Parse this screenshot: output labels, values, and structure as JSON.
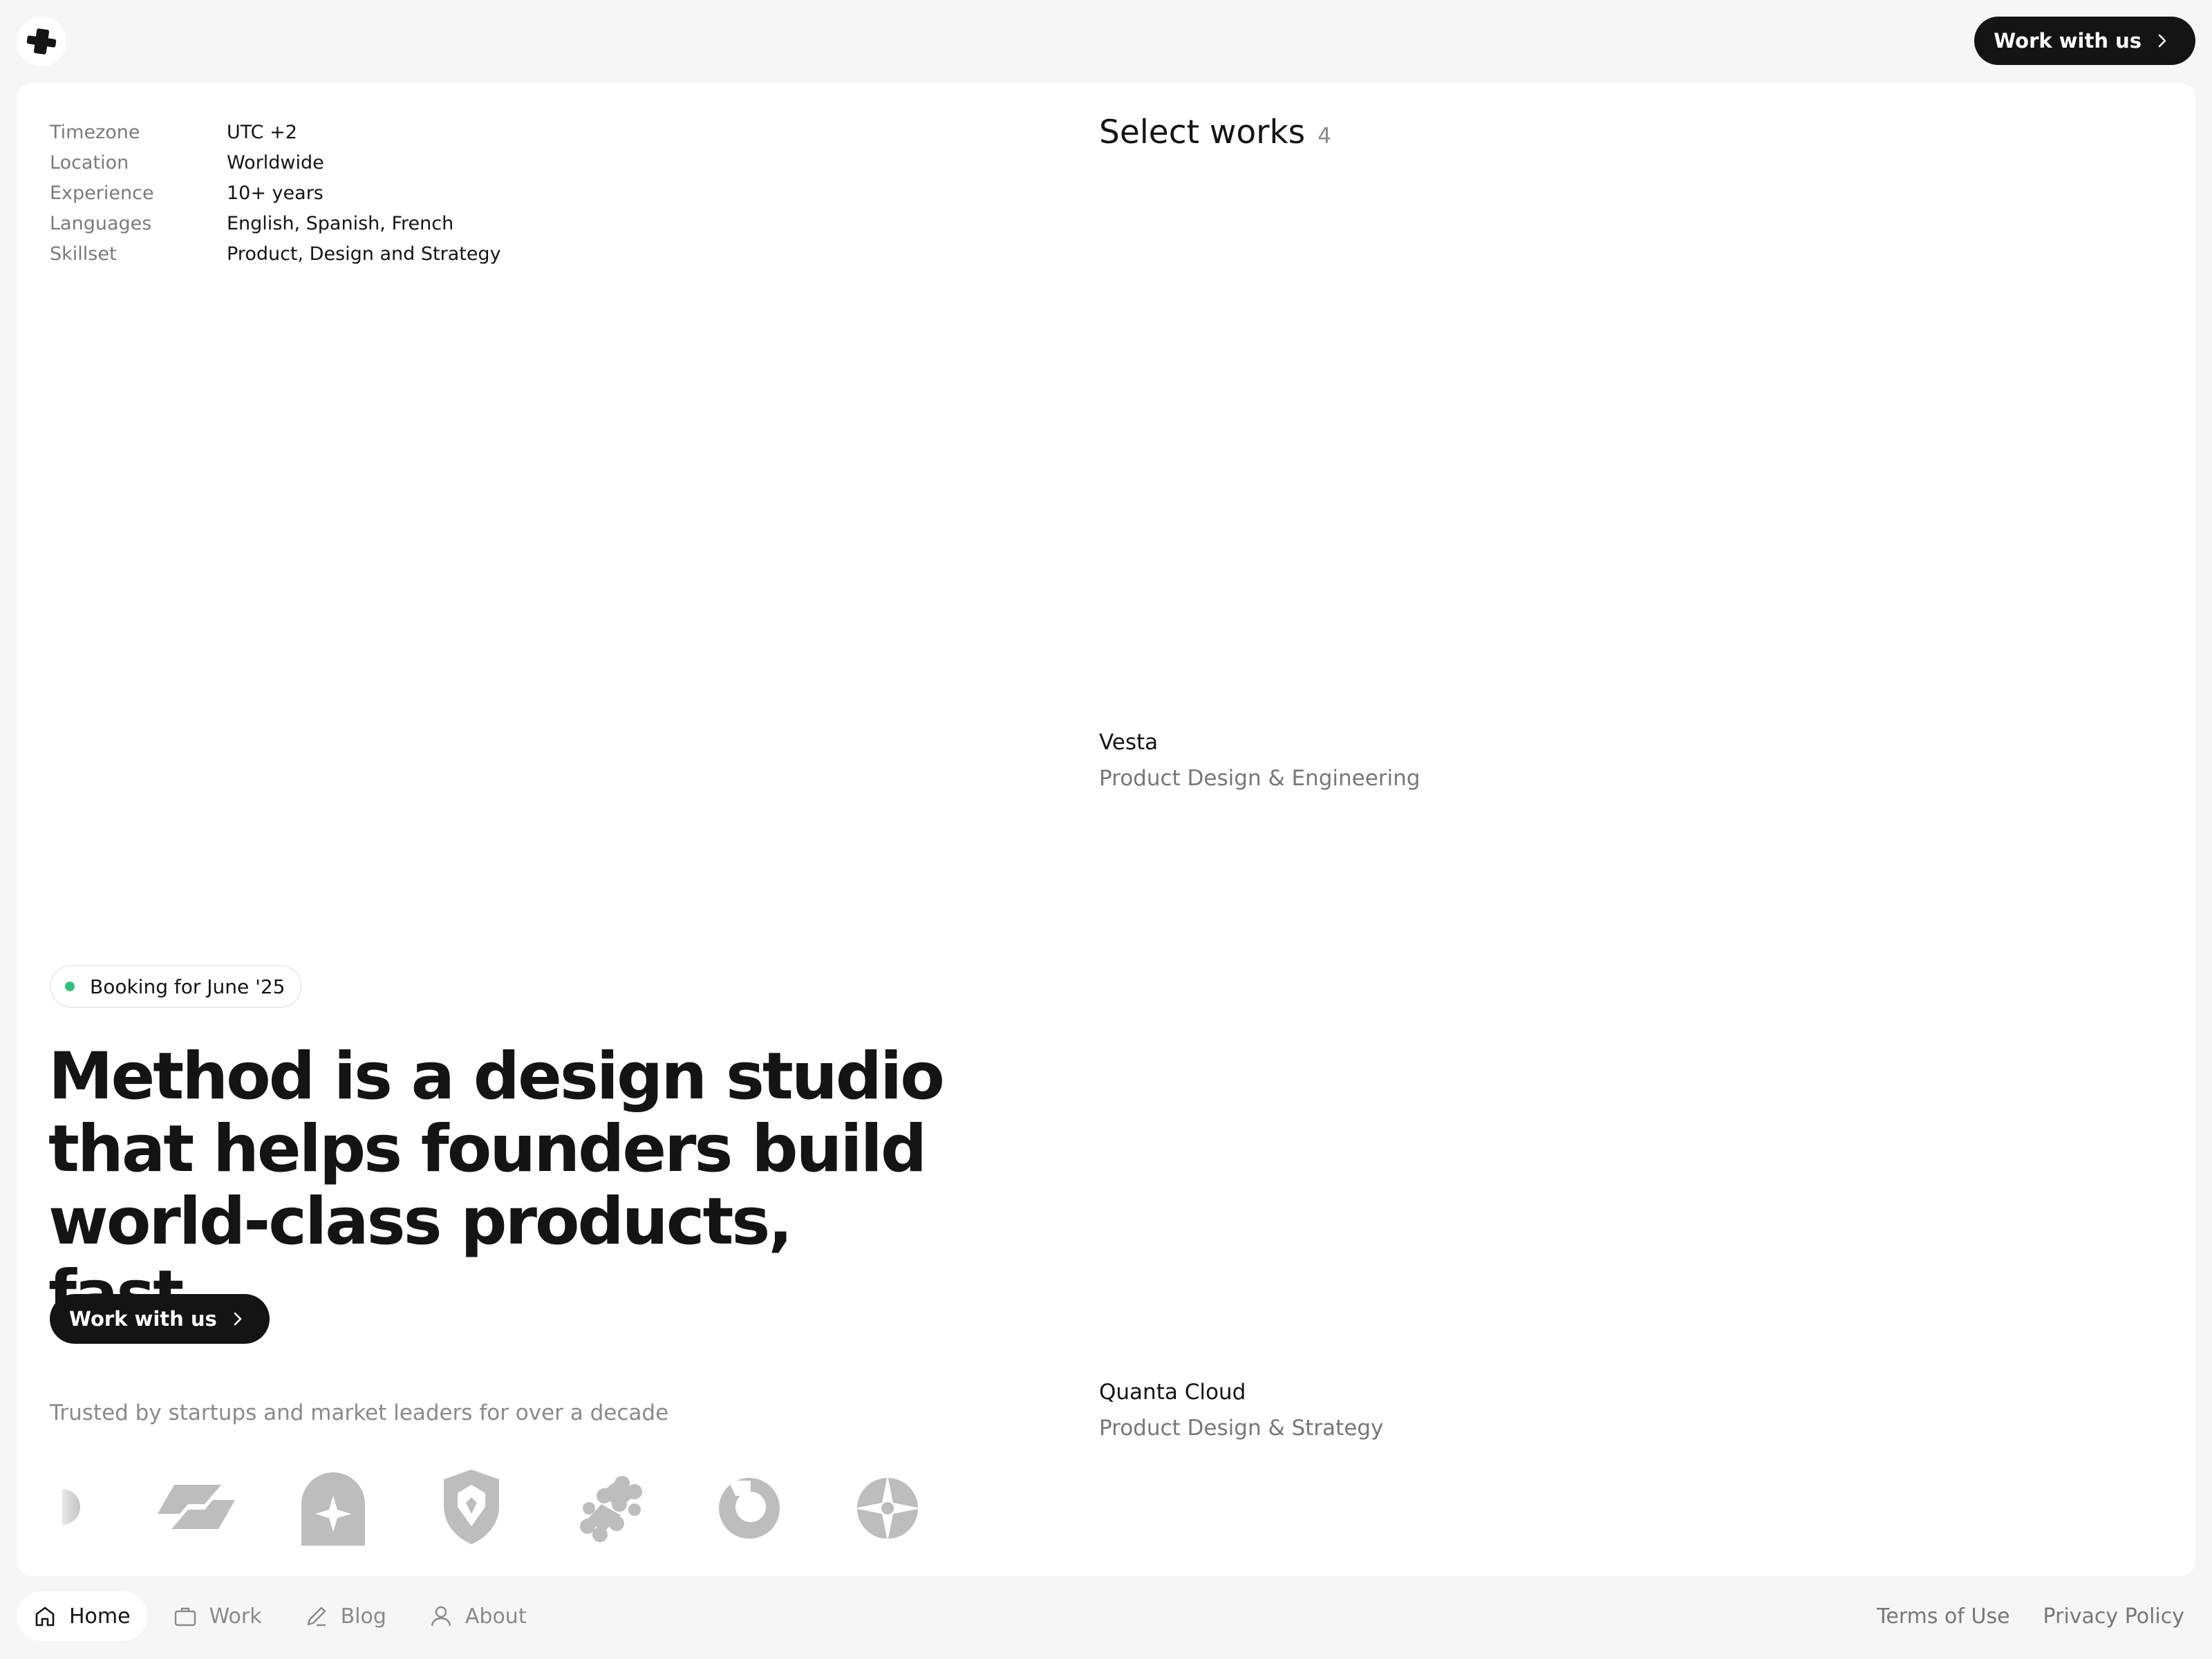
{
  "header": {
    "logo_icon": "plus-icon",
    "cta_label": "Work with us"
  },
  "info": [
    {
      "label": "Timezone",
      "value": "UTC +2"
    },
    {
      "label": "Location",
      "value": "Worldwide"
    },
    {
      "label": "Experience",
      "value": "10+ years"
    },
    {
      "label": "Languages",
      "value": "English, Spanish, French"
    },
    {
      "label": "Skillset",
      "value": "Product, Design and Strategy"
    }
  ],
  "works": {
    "title": "Select works",
    "count": "4",
    "items": [
      {
        "name": "Vesta",
        "category": "Product Design & Engineering"
      },
      {
        "name": "Quanta Cloud",
        "category": "Product Design & Strategy"
      }
    ]
  },
  "hero": {
    "badge": "Booking for June '25",
    "badge_color": "#2fc47e",
    "headline_lines": [
      "Method is a design studio",
      "that helps founders build",
      "world-class products, fast."
    ],
    "cta_label": "Work with us",
    "trusted": "Trusted by startups and market leaders for over a decade"
  },
  "client_logos": [
    "half-circle-logo",
    "link-arrows-logo",
    "arch-star-logo",
    "shield-logo",
    "wave-dots-logo",
    "ring-logo",
    "sparkle-circle-logo"
  ],
  "bottom_nav": [
    {
      "label": "Home",
      "icon": "home-icon",
      "active": true
    },
    {
      "label": "Work",
      "icon": "briefcase-icon",
      "active": false
    },
    {
      "label": "Blog",
      "icon": "pencil-icon",
      "active": false
    },
    {
      "label": "About",
      "icon": "user-icon",
      "active": false
    }
  ],
  "footer": {
    "terms": "Terms of Use",
    "privacy": "Privacy Policy"
  },
  "colors": {
    "background": "#f6f6f6",
    "card": "#ffffff",
    "dark": "#141414",
    "logos": "#bdbdbd"
  }
}
